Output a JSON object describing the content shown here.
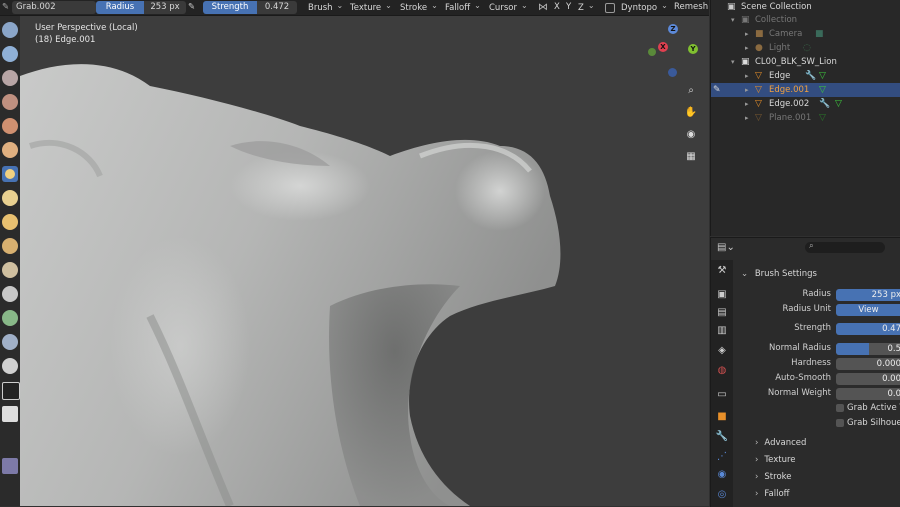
{
  "header": {
    "tool_name": "Grab.002",
    "radius_label": "Radius",
    "radius_value": "253 px",
    "strength_label": "Strength",
    "strength_value": "0.472",
    "menus": [
      "Brush",
      "Texture",
      "Stroke",
      "Falloff",
      "Cursor"
    ],
    "axes": [
      "X",
      "Y",
      "Z"
    ],
    "dyntopo": "Dyntopo",
    "remesh": "Remesh"
  },
  "viewport": {
    "perspective": "User Perspective (Local)",
    "object_info": "(18) Edge.001"
  },
  "gizmo": {
    "x": "X",
    "y": "Y",
    "z": "Z"
  },
  "outliner": {
    "rows": [
      {
        "label": "Scene Collection"
      },
      {
        "label": "Collection"
      },
      {
        "label": "Camera"
      },
      {
        "label": "Light"
      },
      {
        "label": "CL00_BLK_SW_Lion"
      },
      {
        "label": "Edge"
      },
      {
        "label": "Edge.001"
      },
      {
        "label": "Edge.002"
      },
      {
        "label": "Plane.001"
      }
    ]
  },
  "properties": {
    "panel_title": "Brush Settings",
    "radius_label": "Radius",
    "radius_value": "253 px",
    "radius_unit_label": "Radius Unit",
    "radius_unit_value": "View",
    "strength_label": "Strength",
    "strength_value": "0.47",
    "normal_radius_label": "Normal Radius",
    "normal_radius_value": "0.5",
    "normal_radius_fraction": 0.5,
    "hardness_label": "Hardness",
    "hardness_value": "0.000",
    "auto_smooth_label": "Auto-Smooth",
    "auto_smooth_value": "0.00",
    "normal_weight_label": "Normal Weight",
    "normal_weight_value": "0.0",
    "grab_active_label": "Grab Active Ve",
    "grab_silhouette_label": "Grab Silhouett",
    "subpanels": [
      "Advanced",
      "Texture",
      "Stroke",
      "Falloff"
    ]
  },
  "colors": {
    "accent": "#4772b3",
    "selected_row": "#334d80",
    "mesh_icon": "#e8902a",
    "data_icon": "#3ec83e"
  }
}
